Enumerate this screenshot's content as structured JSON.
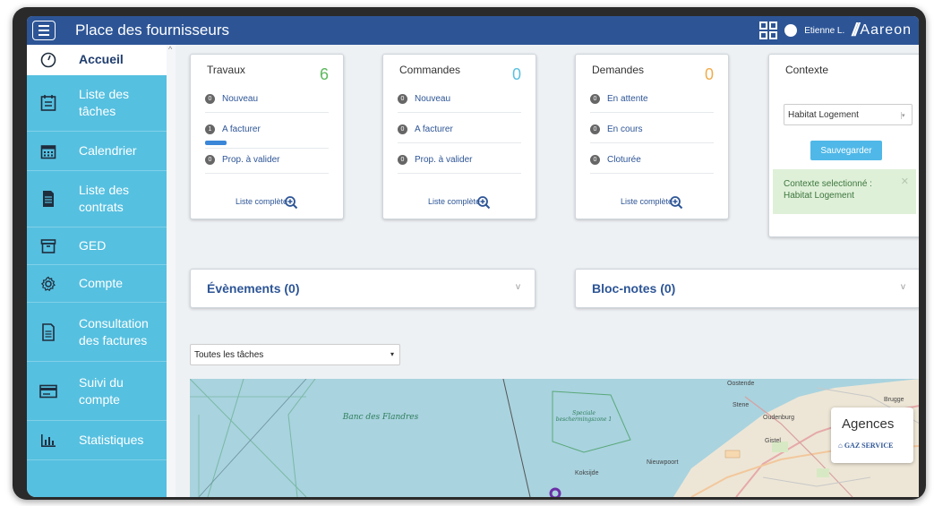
{
  "header": {
    "title": "Place des fournisseurs",
    "user": "Etienne L.",
    "brand": "Aareon"
  },
  "sidebar": {
    "items": [
      {
        "label": "Accueil",
        "icon": "dashboard-icon"
      },
      {
        "label": "Liste des tâches",
        "icon": "task-list-icon"
      },
      {
        "label": "Calendrier",
        "icon": "calendar-icon"
      },
      {
        "label": "Liste des contrats",
        "icon": "contract-icon"
      },
      {
        "label": "GED",
        "icon": "archive-icon"
      },
      {
        "label": "Compte",
        "icon": "gear-icon"
      },
      {
        "label": "Consultation des factures",
        "icon": "invoice-icon"
      },
      {
        "label": "Suivi du compte",
        "icon": "account-icon"
      },
      {
        "label": "Statistiques",
        "icon": "stats-icon"
      }
    ]
  },
  "cards": {
    "travaux": {
      "title": "Travaux",
      "count": "6",
      "count_color": "#5cb85c",
      "rows": [
        {
          "badge": "0",
          "label": "Nouveau"
        },
        {
          "badge": "1",
          "label": "A facturer"
        },
        {
          "badge": "0",
          "label": "Prop. à valider"
        }
      ],
      "link": "Liste complète"
    },
    "commandes": {
      "title": "Commandes",
      "count": "0",
      "count_color": "#5bc0de",
      "rows": [
        {
          "badge": "0",
          "label": "Nouveau"
        },
        {
          "badge": "0",
          "label": "A facturer"
        },
        {
          "badge": "0",
          "label": "Prop. à valider"
        }
      ],
      "link": "Liste complète"
    },
    "demandes": {
      "title": "Demandes",
      "count": "0",
      "count_color": "#f0ad4e",
      "rows": [
        {
          "badge": "0",
          "label": "En attente"
        },
        {
          "badge": "0",
          "label": "En cours"
        },
        {
          "badge": "0",
          "label": "Cloturée"
        }
      ],
      "link": "Liste complète"
    },
    "contexte": {
      "title": "Contexte",
      "select_value": "Habitat Logement",
      "save_label": "Sauvegarder",
      "alert_line1": "Contexte selectionné :",
      "alert_line2": "Habitat Logement"
    }
  },
  "panels": {
    "events": "Évènements (0)",
    "notes": "Bloc-notes (0)"
  },
  "filter": {
    "value": "Toutes les tâches"
  },
  "map": {
    "labels": {
      "banc": "Banc des Flandres",
      "zone": "Speciale beschermingszone 1",
      "oostende": "Oostende",
      "brugge": "Brugge",
      "oudenburg": "Oudenburg",
      "nieuwpoort": "Nieuwpoort",
      "koksijde": "Koksijde",
      "gistel": "Gistel",
      "stene": "Stene"
    },
    "legend_title": "Agences",
    "legend_item": "GAZ SERVICE"
  },
  "colors": {
    "header_bg": "#2d5596",
    "sidebar_bg": "#56c0e0",
    "link": "#2d5596"
  }
}
